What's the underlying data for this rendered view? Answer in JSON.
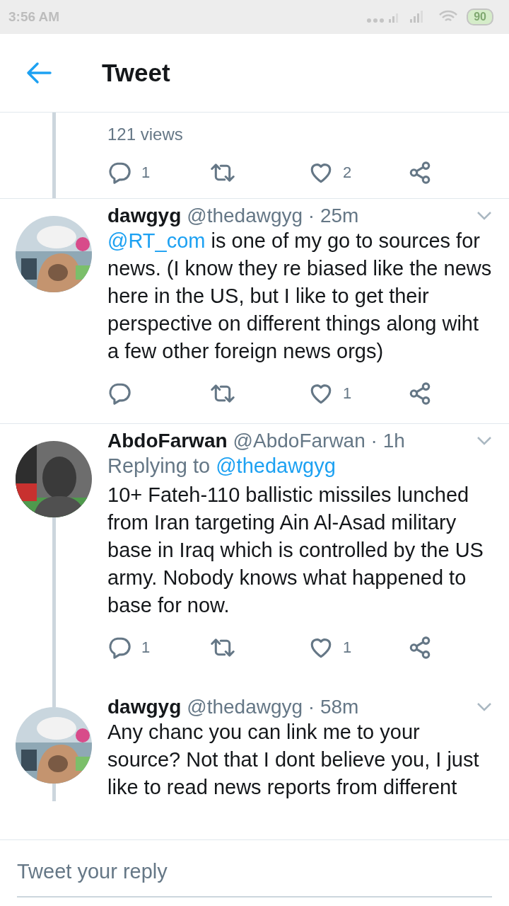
{
  "status_bar": {
    "time": "3:56 AM",
    "battery": "90"
  },
  "header": {
    "title": "Tweet"
  },
  "top": {
    "views": "121 views",
    "actions": {
      "replies": "1",
      "likes": "2"
    }
  },
  "tweets": [
    {
      "name": "dawgyg",
      "handle": "@thedawgyg",
      "time": "· 25m",
      "connected_above": false,
      "connected_below": false,
      "body": [
        {
          "kind": "mention",
          "text": "@RT_com"
        },
        {
          "kind": "text",
          "text": " is one of my go to sources for news. (I know they re biased like the news here in the US, but I like to get their perspective on different things along wiht a few other foreign news orgs)"
        }
      ],
      "actions": {
        "likes": "1"
      }
    },
    {
      "name": "AbdoFarwan",
      "handle": "@AbdoFarwan",
      "time": "· 1h",
      "connected_above": false,
      "connected_below": true,
      "replying_to": {
        "label": "Replying to",
        "mention": "@thedawgyg"
      },
      "body": [
        {
          "kind": "text",
          "text": "10+ Fateh-110 ballistic missiles lunched from Iran targeting Ain Al-Asad military base in Iraq which is controlled by the US army. Nobody knows what happened to base for now."
        }
      ],
      "actions": {
        "replies": "1",
        "likes": "1"
      }
    },
    {
      "name": "dawgyg",
      "handle": "@thedawgyg",
      "time": "· 58m",
      "connected_above": true,
      "connected_below": true,
      "body": [
        {
          "kind": "text",
          "text": "Any chanc you can link me to your source? Not that I dont believe you, I just like to read news reports from different"
        }
      ]
    }
  ],
  "reply_bar": {
    "placeholder": "Tweet your reply"
  }
}
